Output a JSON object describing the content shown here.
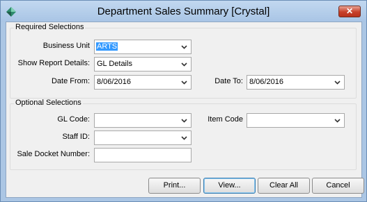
{
  "window": {
    "title": "Department Sales Summary  [Crystal]",
    "close_glyph": "✕",
    "icon": "app-diamond-icon"
  },
  "required": {
    "legend": "Required Selections",
    "business_unit": {
      "label": "Business Unit",
      "value": "ARTS"
    },
    "show_report_details": {
      "label": "Show Report Details:",
      "value": "GL Details"
    },
    "date_from": {
      "label": "Date From:",
      "value": "8/06/2016"
    },
    "date_to": {
      "label": "Date To:",
      "value": "8/06/2016"
    }
  },
  "optional": {
    "legend": "Optional Selections",
    "gl_code": {
      "label": "GL Code:",
      "value": ""
    },
    "item_code": {
      "label": "Item Code",
      "value": ""
    },
    "staff_id": {
      "label": "Staff ID:",
      "value": ""
    },
    "sale_docket_number": {
      "label": "Sale Docket Number:",
      "value": ""
    }
  },
  "buttons": {
    "print": "Print...",
    "view": "View...",
    "clear_all": "Clear All",
    "cancel": "Cancel"
  },
  "colors": {
    "selection": "#3399ff",
    "close_button": "#c7402a",
    "title_bar": "#a9c5e5"
  }
}
